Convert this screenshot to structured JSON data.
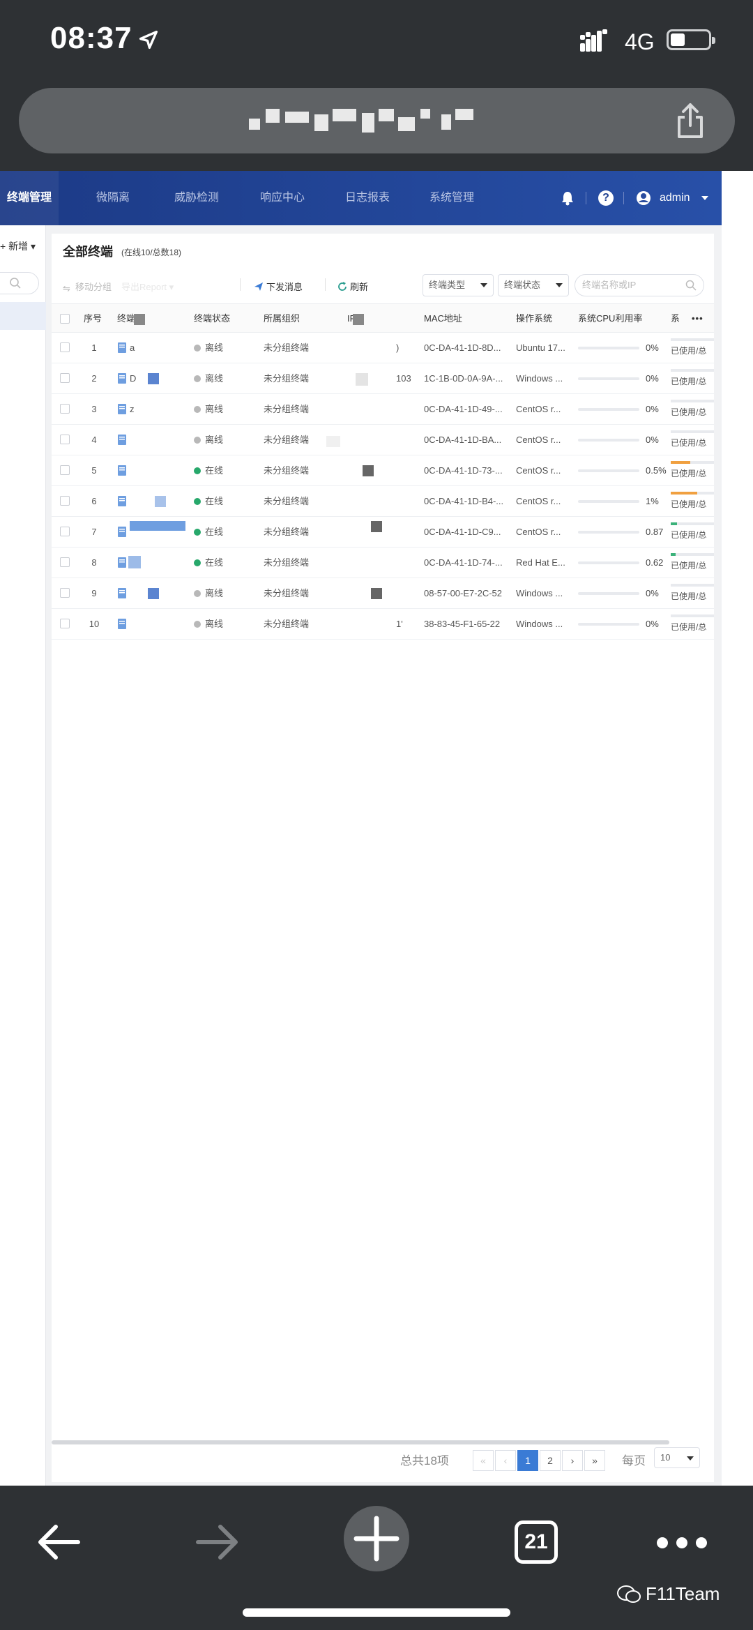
{
  "status_bar": {
    "time": "08:37",
    "network": "4G"
  },
  "nav": {
    "items": [
      "终端管理",
      "微隔离",
      "威胁检测",
      "响应中心",
      "日志报表",
      "系统管理"
    ],
    "user": "admin"
  },
  "sidebar": {
    "new_label": "新增"
  },
  "panel": {
    "title": "全部终端",
    "subtitle": "(在线10/总数18)",
    "toolbar": {
      "move_group": "移动分组",
      "export": "导出Report",
      "send_message": "下发消息",
      "refresh": "刷新"
    },
    "filters": {
      "terminal_type": "终端类型",
      "terminal_status": "终端状态",
      "search_placeholder": "终端名称或IP"
    }
  },
  "table": {
    "headers": {
      "index": "序号",
      "name": "终端",
      "status": "终端状态",
      "group": "所属组织",
      "ip": "IP",
      "mac": "MAC地址",
      "os": "操作系统",
      "cpu": "系统CPU利用率",
      "mem": "系"
    },
    "rows": [
      {
        "index": "1",
        "name": "a",
        "status": "离线",
        "online": false,
        "group": "未分组终端",
        "ip": ")",
        "mac": "0C-DA-41-1D-8D...",
        "os": "Ubuntu 17...",
        "cpu": "0%",
        "cpu_pct": 0,
        "mem": "已使用/总",
        "mem_pct": 0,
        "mem_color": "#e8eaee"
      },
      {
        "index": "2",
        "name": "D",
        "status": "离线",
        "online": false,
        "group": "未分组终端",
        "ip": "103",
        "mac": "1C-1B-0D-0A-9A-...",
        "os": "Windows ...",
        "cpu": "0%",
        "cpu_pct": 0,
        "mem": "已使用/总",
        "mem_pct": 0,
        "mem_color": "#e8eaee"
      },
      {
        "index": "3",
        "name": "z",
        "status": "离线",
        "online": false,
        "group": "未分组终端",
        "ip": "",
        "mac": "0C-DA-41-1D-49-...",
        "os": "CentOS r...",
        "cpu": "0%",
        "cpu_pct": 0,
        "mem": "已使用/总",
        "mem_pct": 0,
        "mem_color": "#e8eaee"
      },
      {
        "index": "4",
        "name": "",
        "status": "离线",
        "online": false,
        "group": "未分组终端",
        "ip": "",
        "mac": "0C-DA-41-1D-BA...",
        "os": "CentOS r...",
        "cpu": "0%",
        "cpu_pct": 0,
        "mem": "已使用/总",
        "mem_pct": 0,
        "mem_color": "#e8eaee"
      },
      {
        "index": "5",
        "name": "",
        "status": "在线",
        "online": true,
        "group": "未分组终端",
        "ip": "",
        "mac": "0C-DA-41-1D-73-...",
        "os": "CentOS r...",
        "cpu": "0.5%",
        "cpu_pct": 0.5,
        "mem": "已使用/总",
        "mem_pct": 45,
        "mem_color": "#f0a040"
      },
      {
        "index": "6",
        "name": "",
        "status": "在线",
        "online": true,
        "group": "未分组终端",
        "ip": "",
        "mac": "0C-DA-41-1D-B4-...",
        "os": "CentOS r...",
        "cpu": "1%",
        "cpu_pct": 1,
        "mem": "已使用/总",
        "mem_pct": 62,
        "mem_color": "#f0a040"
      },
      {
        "index": "7",
        "name": "",
        "status": "在线",
        "online": true,
        "group": "未分组终端",
        "ip": "",
        "mac": "0C-DA-41-1D-C9...",
        "os": "CentOS r...",
        "cpu": "0.87",
        "cpu_pct": 0.87,
        "mem": "已使用/总",
        "mem_pct": 15,
        "mem_color": "#3bb27a"
      },
      {
        "index": "8",
        "name": "",
        "status": "在线",
        "online": true,
        "group": "未分组终端",
        "ip": "",
        "mac": "0C-DA-41-1D-74-...",
        "os": "Red Hat E...",
        "cpu": "0.62",
        "cpu_pct": 0.62,
        "mem": "已使用/总",
        "mem_pct": 12,
        "mem_color": "#3bb27a"
      },
      {
        "index": "9",
        "name": "",
        "status": "离线",
        "online": false,
        "group": "未分组终端",
        "ip": "",
        "mac": "08-57-00-E7-2C-52",
        "os": "Windows ...",
        "cpu": "0%",
        "cpu_pct": 0,
        "mem": "已使用/总",
        "mem_pct": 0,
        "mem_color": "#e8eaee"
      },
      {
        "index": "10",
        "name": "",
        "status": "离线",
        "online": false,
        "group": "未分组终端",
        "ip": "1'",
        "mac": "38-83-45-F1-65-22",
        "os": "Windows ...",
        "cpu": "0%",
        "cpu_pct": 0,
        "mem": "已使用/总",
        "mem_pct": 0,
        "mem_color": "#e8eaee"
      }
    ]
  },
  "pagination": {
    "total": "总共18项",
    "pages": [
      "1",
      "2"
    ],
    "current": "1",
    "per_page_label": "每页",
    "per_page": "10"
  },
  "browser": {
    "tab_count": "21"
  },
  "watermark": "F11Team",
  "colors": {
    "online": "#27a86b",
    "offline": "#b8b8b8",
    "nav_bg": "#1f418f",
    "accent": "#3a7bd5"
  }
}
